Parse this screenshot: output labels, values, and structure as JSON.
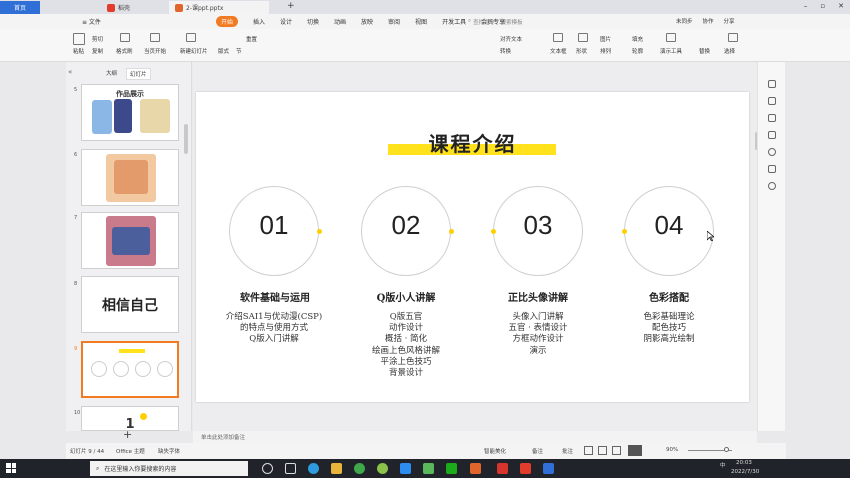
{
  "titlebar": {
    "home_tab": "首页",
    "dao_tab": "稻壳",
    "file_tab": "2-课ppt.pptx",
    "new_tab": "+",
    "minimize": "–",
    "restore": "▫",
    "close": "✕"
  },
  "menubar": {
    "file_label": "≡ 文件",
    "items": [
      "开始",
      "插入",
      "设计",
      "切换",
      "动画",
      "放映",
      "审阅",
      "视图",
      "开发工具",
      "会员专享"
    ],
    "active_index": 0,
    "search_placeholder": "查找命令、搜索模板",
    "right_items": [
      "未同步",
      "协作",
      "分享"
    ]
  },
  "toolbar": {
    "paste": "粘贴",
    "cut": "剪切",
    "copy": "复制",
    "format_painter": "格式刷",
    "current_slide": "当页开始",
    "new_slide": "新建幻灯片",
    "layout": "版式",
    "section": "节",
    "redo": "重置",
    "text_box": "文本框",
    "shape": "形状",
    "arrange": "排列",
    "picture": "图片",
    "fill": "填充",
    "outline": "轮廓",
    "present": "演示工具",
    "replace": "替换",
    "select": "选择",
    "align_text": "对齐文本",
    "convert": "转换",
    "text_effect": "文字效果"
  },
  "leftpanel": {
    "tab_outline": "大纲",
    "tab_slides": "幻灯片",
    "collapse": "«",
    "slides": [
      {
        "num": "5",
        "title": "作品展示"
      },
      {
        "num": "6",
        "title": ""
      },
      {
        "num": "7",
        "title": ""
      },
      {
        "num": "8",
        "title": "相信自己"
      },
      {
        "num": "9",
        "title": ""
      },
      {
        "num": "10",
        "title": "1"
      }
    ],
    "add_button": "+"
  },
  "slide": {
    "title": "课程介绍",
    "items": [
      {
        "num": "01",
        "heading": "软件基础与运用",
        "lines": [
          "介绍SAI1与优动漫(CSP)",
          "的特点与使用方式",
          "Q版入门讲解"
        ]
      },
      {
        "num": "02",
        "heading": "Q版小人讲解",
        "lines": [
          "Q版五官",
          "动作设计",
          "概括 · 简化",
          "绘画上色风格讲解",
          "平涂上色技巧",
          "背景设计"
        ]
      },
      {
        "num": "03",
        "heading": "正比头像讲解",
        "lines": [
          "头像入门讲解",
          "五官 · 表情设计",
          "方框动作设计",
          "演示"
        ]
      },
      {
        "num": "04",
        "heading": "色彩搭配",
        "lines": [
          "色彩基础理论",
          "配色技巧",
          "阴影高光绘制"
        ]
      }
    ]
  },
  "notes": {
    "placeholder": "单击此处添加备注"
  },
  "status": {
    "slide_count": "幻灯片 9 / 44",
    "theme": "Office 主题",
    "font_missing": "缺失字体",
    "smart_beautify": "智能美化",
    "notes": "备注",
    "comments": "批注",
    "zoom": "90%"
  },
  "taskbar": {
    "search_placeholder": "在这里输入你要搜索的内容",
    "time": "20:03",
    "date": "2022/7/30",
    "lang": "中"
  },
  "colors": {
    "accent": "#f27b21",
    "title_highlight": "#ffe21c",
    "dot": "#ffcf00"
  }
}
